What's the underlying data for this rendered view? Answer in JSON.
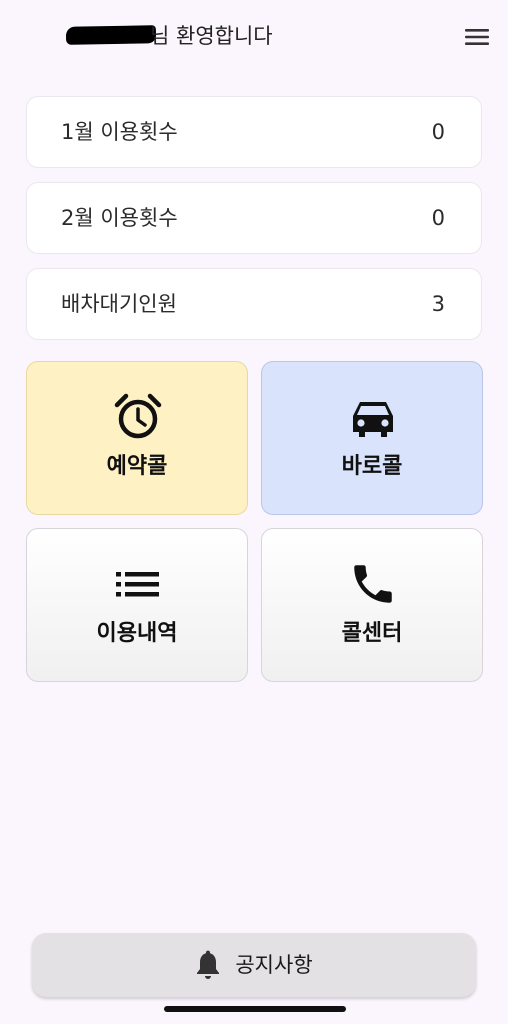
{
  "header": {
    "welcome_text": "님 환영합니다",
    "menu_icon": "hamburger-menu-icon"
  },
  "stats": [
    {
      "label": "1월 이용횟수",
      "value": "0"
    },
    {
      "label": "2월 이용횟수",
      "value": "0"
    },
    {
      "label": "배차대기인원",
      "value": "3"
    }
  ],
  "actions": [
    {
      "label": "예약콜",
      "icon": "alarm-clock-icon",
      "bg": "#fef1c4"
    },
    {
      "label": "바로콜",
      "icon": "car-icon",
      "bg": "#d9e3fc"
    },
    {
      "label": "이용내역",
      "icon": "list-icon",
      "bg": "#f5f5f5"
    },
    {
      "label": "콜센터",
      "icon": "phone-icon",
      "bg": "#f5f5f5"
    }
  ],
  "notice": {
    "label": "공지사항",
    "icon": "bell-icon"
  }
}
